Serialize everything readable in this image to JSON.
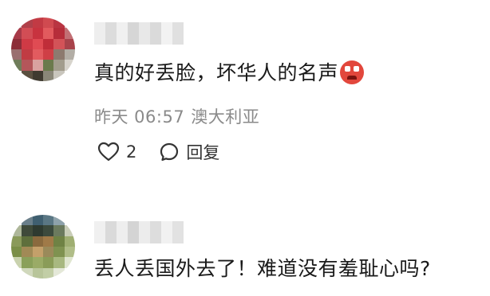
{
  "comments": [
    {
      "text": "真的好丢脸，坏华人的名声",
      "emoji": "angry-devil-emoji",
      "time": "昨天 06:57",
      "location": "澳大利亚",
      "like_count": "2",
      "reply_label": "回复"
    },
    {
      "text": "丢人丢国外去了！难道没有羞耻心吗?"
    }
  ],
  "colors": {
    "meta_text": "#8a8a8a",
    "body_text": "#1a1a1a",
    "background": "#ffffff"
  }
}
